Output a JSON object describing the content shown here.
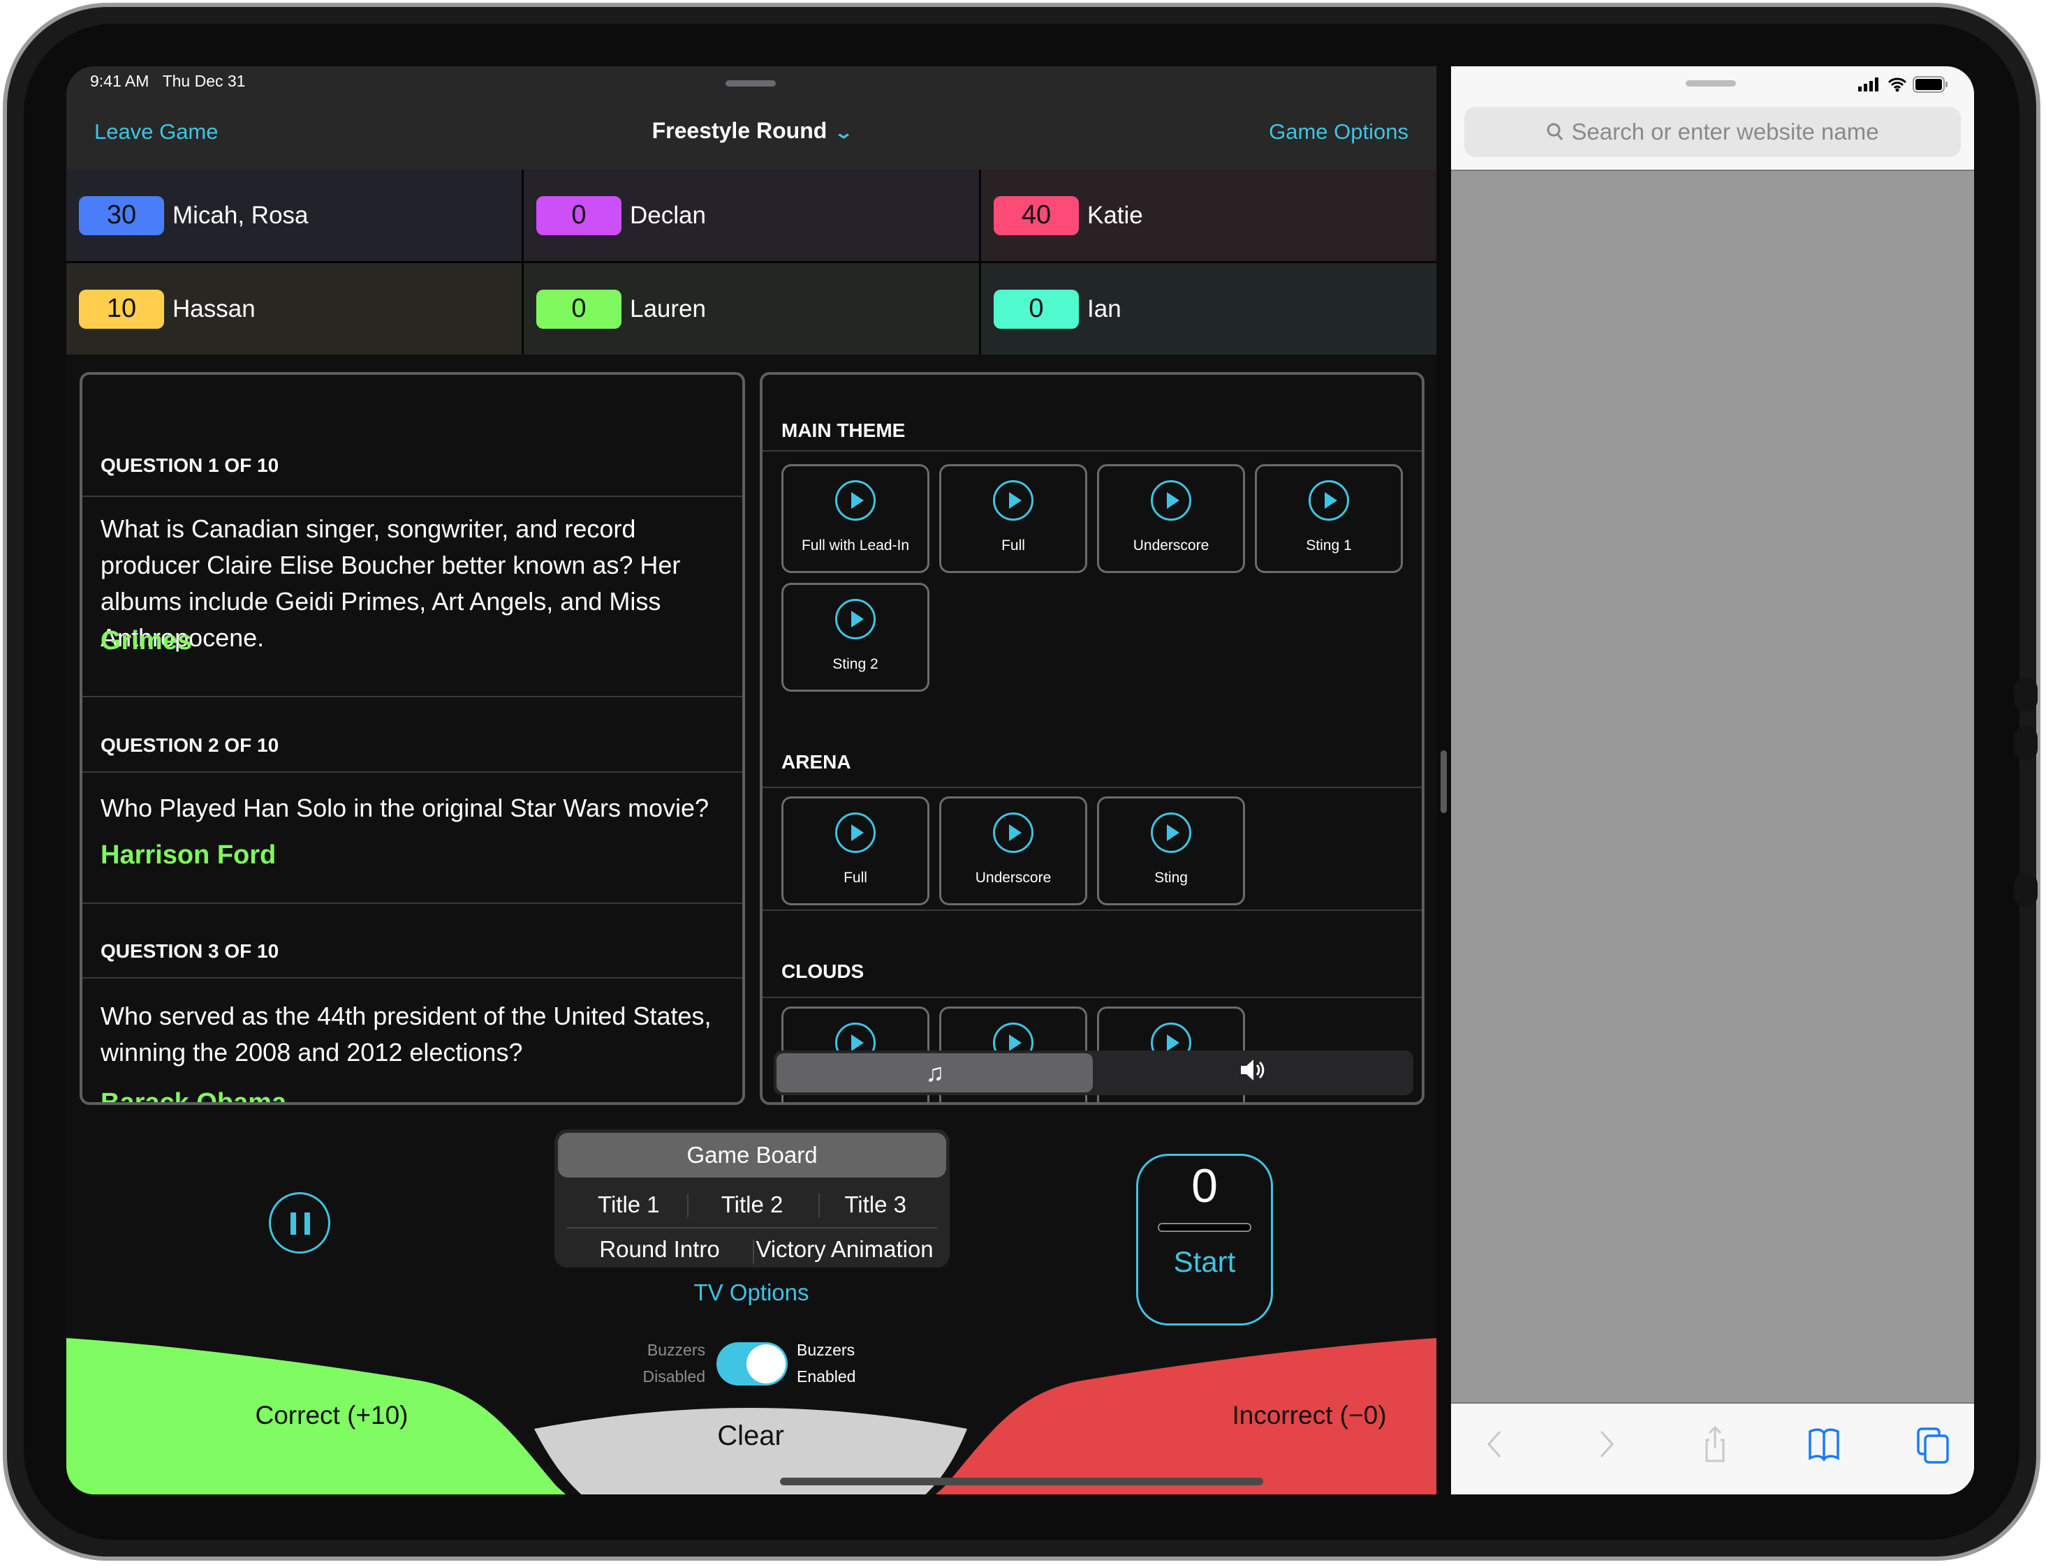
{
  "status_bar": {
    "time": "9:41 AM",
    "date": "Thu Dec 31"
  },
  "nav": {
    "left": "Leave Game",
    "title": "Freestyle Round",
    "title_chevron": "chevron-down-icon",
    "right": "Game Options"
  },
  "scores": [
    {
      "score": "30",
      "name": "Micah, Rosa",
      "color": "#4a7dfa",
      "bg": "#22232a"
    },
    {
      "score": "0",
      "name": "Declan",
      "color": "#cc4ff8",
      "bg": "#25222a"
    },
    {
      "score": "40",
      "name": "Katie",
      "color": "#fd4a76",
      "bg": "#2a2124"
    },
    {
      "score": "10",
      "name": "Hassan",
      "color": "#fece4c",
      "bg": "#282722"
    },
    {
      "score": "0",
      "name": "Lauren",
      "color": "#80f95e",
      "bg": "#232722"
    },
    {
      "score": "0",
      "name": "Ian",
      "color": "#50fbd0",
      "bg": "#212726"
    }
  ],
  "questions": [
    {
      "header": "QUESTION 1 OF 10",
      "text": "What is Canadian singer, songwriter, and record producer Claire Elise Boucher better known as? Her albums include Geidi Primes, Art Angels, and Miss Anthropocene.",
      "answer": "Grimes"
    },
    {
      "header": "QUESTION 2 OF 10",
      "text": "Who Played Han Solo in the original Star Wars movie?",
      "answer": "Harrison Ford"
    },
    {
      "header": "QUESTION 3 OF 10",
      "text": "Who served as the 44th president of the United States, winning the 2008 and 2012 elections?",
      "answer": "Barack Obama"
    }
  ],
  "music": {
    "sections": [
      {
        "title": "MAIN THEME",
        "cues": [
          "Full with Lead-In",
          "Full",
          "Underscore",
          "Sting 1",
          "Sting 2"
        ]
      },
      {
        "title": "ARENA",
        "cues": [
          "Full",
          "Underscore",
          "Sting"
        ]
      },
      {
        "title": "CLOUDS",
        "cues": [
          "",
          "",
          ""
        ]
      }
    ],
    "tabs": [
      {
        "icon": "music-note-icon",
        "glyph": "♫",
        "selected": true
      },
      {
        "icon": "speaker-icon",
        "glyph": "🔈",
        "selected": false
      }
    ]
  },
  "controls": {
    "pause_icon": "pause-icon",
    "tv": {
      "main": "Game Board",
      "row1": [
        "Title 1",
        "Title 2",
        "Title 3"
      ],
      "row2": [
        "Round Intro",
        "Victory Animation"
      ],
      "options_link": "TV Options"
    },
    "timer": {
      "value": "0",
      "start_label": "Start"
    },
    "buzzers": {
      "off_line1": "Buzzers",
      "off_line2": "Disabled",
      "on_line1": "Buzzers",
      "on_line2": "Enabled",
      "enabled": true
    }
  },
  "judging": {
    "correct": "Correct (+10)",
    "clear": "Clear",
    "incorrect": "Incorrect (−0)",
    "correct_color": "#80fc63",
    "incorrect_color": "#e34549",
    "clear_color": "#d0d0d0"
  },
  "safari": {
    "search_placeholder": "Search or enter website name",
    "toolbar": [
      "back-icon",
      "forward-icon",
      "share-icon",
      "bookmarks-icon",
      "tabs-icon"
    ]
  },
  "colors": {
    "accent": "#3fc4e3",
    "answer": "#80f95e"
  }
}
